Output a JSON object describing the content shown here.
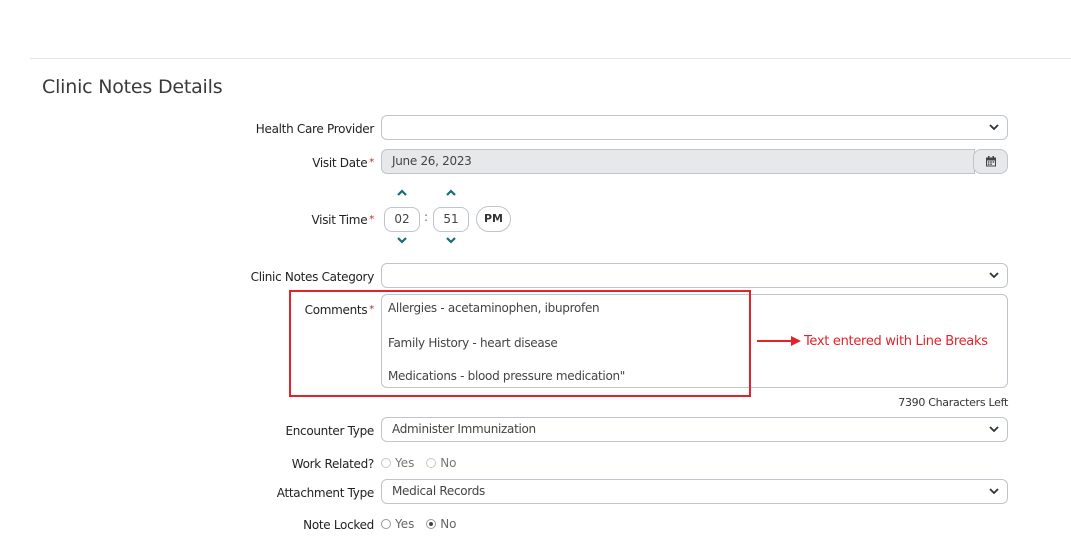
{
  "page": {
    "title": "Clinic Notes Details"
  },
  "form": {
    "health_care_provider": {
      "label": "Health Care Provider",
      "value": ""
    },
    "visit_date": {
      "label": "Visit Date",
      "required": "*",
      "value": "June 26, 2023"
    },
    "visit_time": {
      "label": "Visit Time",
      "required": "*",
      "hour": "02",
      "minute": "51",
      "separator": ":",
      "ampm": "PM"
    },
    "clinic_notes_category": {
      "label": "Clinic Notes Category",
      "value": ""
    },
    "comments": {
      "label": "Comments",
      "required": "*",
      "lines": [
        "Allergies - acetaminophen, ibuprofen",
        "Family History - heart disease",
        "Medications - blood pressure medication\""
      ],
      "chars_left": "7390 Characters Left"
    },
    "encounter_type": {
      "label": "Encounter Type",
      "value": "Administer Immunization"
    },
    "work_related": {
      "label": "Work Related?",
      "options": [
        "Yes",
        "No"
      ],
      "selected": ""
    },
    "attachment_type": {
      "label": "Attachment Type",
      "value": "Medical Records"
    },
    "note_locked": {
      "label": "Note Locked",
      "options": [
        "Yes",
        "No"
      ],
      "selected": "No"
    }
  },
  "annotation": {
    "text": "Text entered with Line Breaks",
    "color": "#e2232a"
  },
  "icons": {
    "dropdown": "chevron-down-icon",
    "calendar": "calendar-icon",
    "spinner_up": "chevron-up-icon",
    "spinner_down": "chevron-down-icon"
  },
  "colors": {
    "accent_teal": "#1b6b73",
    "required_red": "#c0282e",
    "annotation_red": "#e2232a"
  }
}
